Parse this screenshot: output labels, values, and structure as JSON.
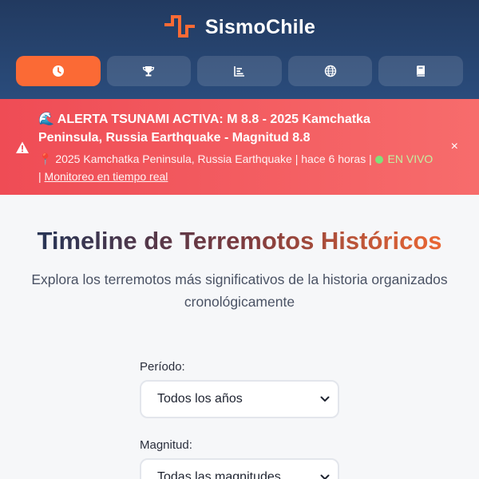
{
  "app": {
    "name": "SismoChile"
  },
  "nav": {
    "tabs": [
      {
        "icon": "clock-icon",
        "active": true
      },
      {
        "icon": "trophy-icon",
        "active": false
      },
      {
        "icon": "bar-chart-icon",
        "active": false
      },
      {
        "icon": "globe-icon",
        "active": false
      },
      {
        "icon": "book-icon",
        "active": false
      }
    ]
  },
  "alert": {
    "title": "🌊 ALERTA TSUNAMI ACTIVA: M 8.8 - 2025 Kamchatka Peninsula, Russia Earthquake - Magnitud 8.8",
    "location": "📍 2025 Kamchatka Peninsula, Russia Earthquake",
    "time": "hace 6 horas",
    "separator": " | ",
    "live": "EN VIVO",
    "link": "Monitoreo en tiempo real",
    "close": "×",
    "icon": "warning-icon"
  },
  "main": {
    "title": "Timeline de Terremotos Históricos",
    "subtitle": "Explora los terremotos más significativos de la historia organizados cronológicamente"
  },
  "filters": {
    "period": {
      "label": "Período:",
      "value": "Todos los años"
    },
    "magnitude": {
      "label": "Magnitud:",
      "value": "Todas las magnitudes"
    }
  },
  "colors": {
    "header": "#223a60",
    "accent": "#fb6a35",
    "alert": "#ef4c55"
  }
}
